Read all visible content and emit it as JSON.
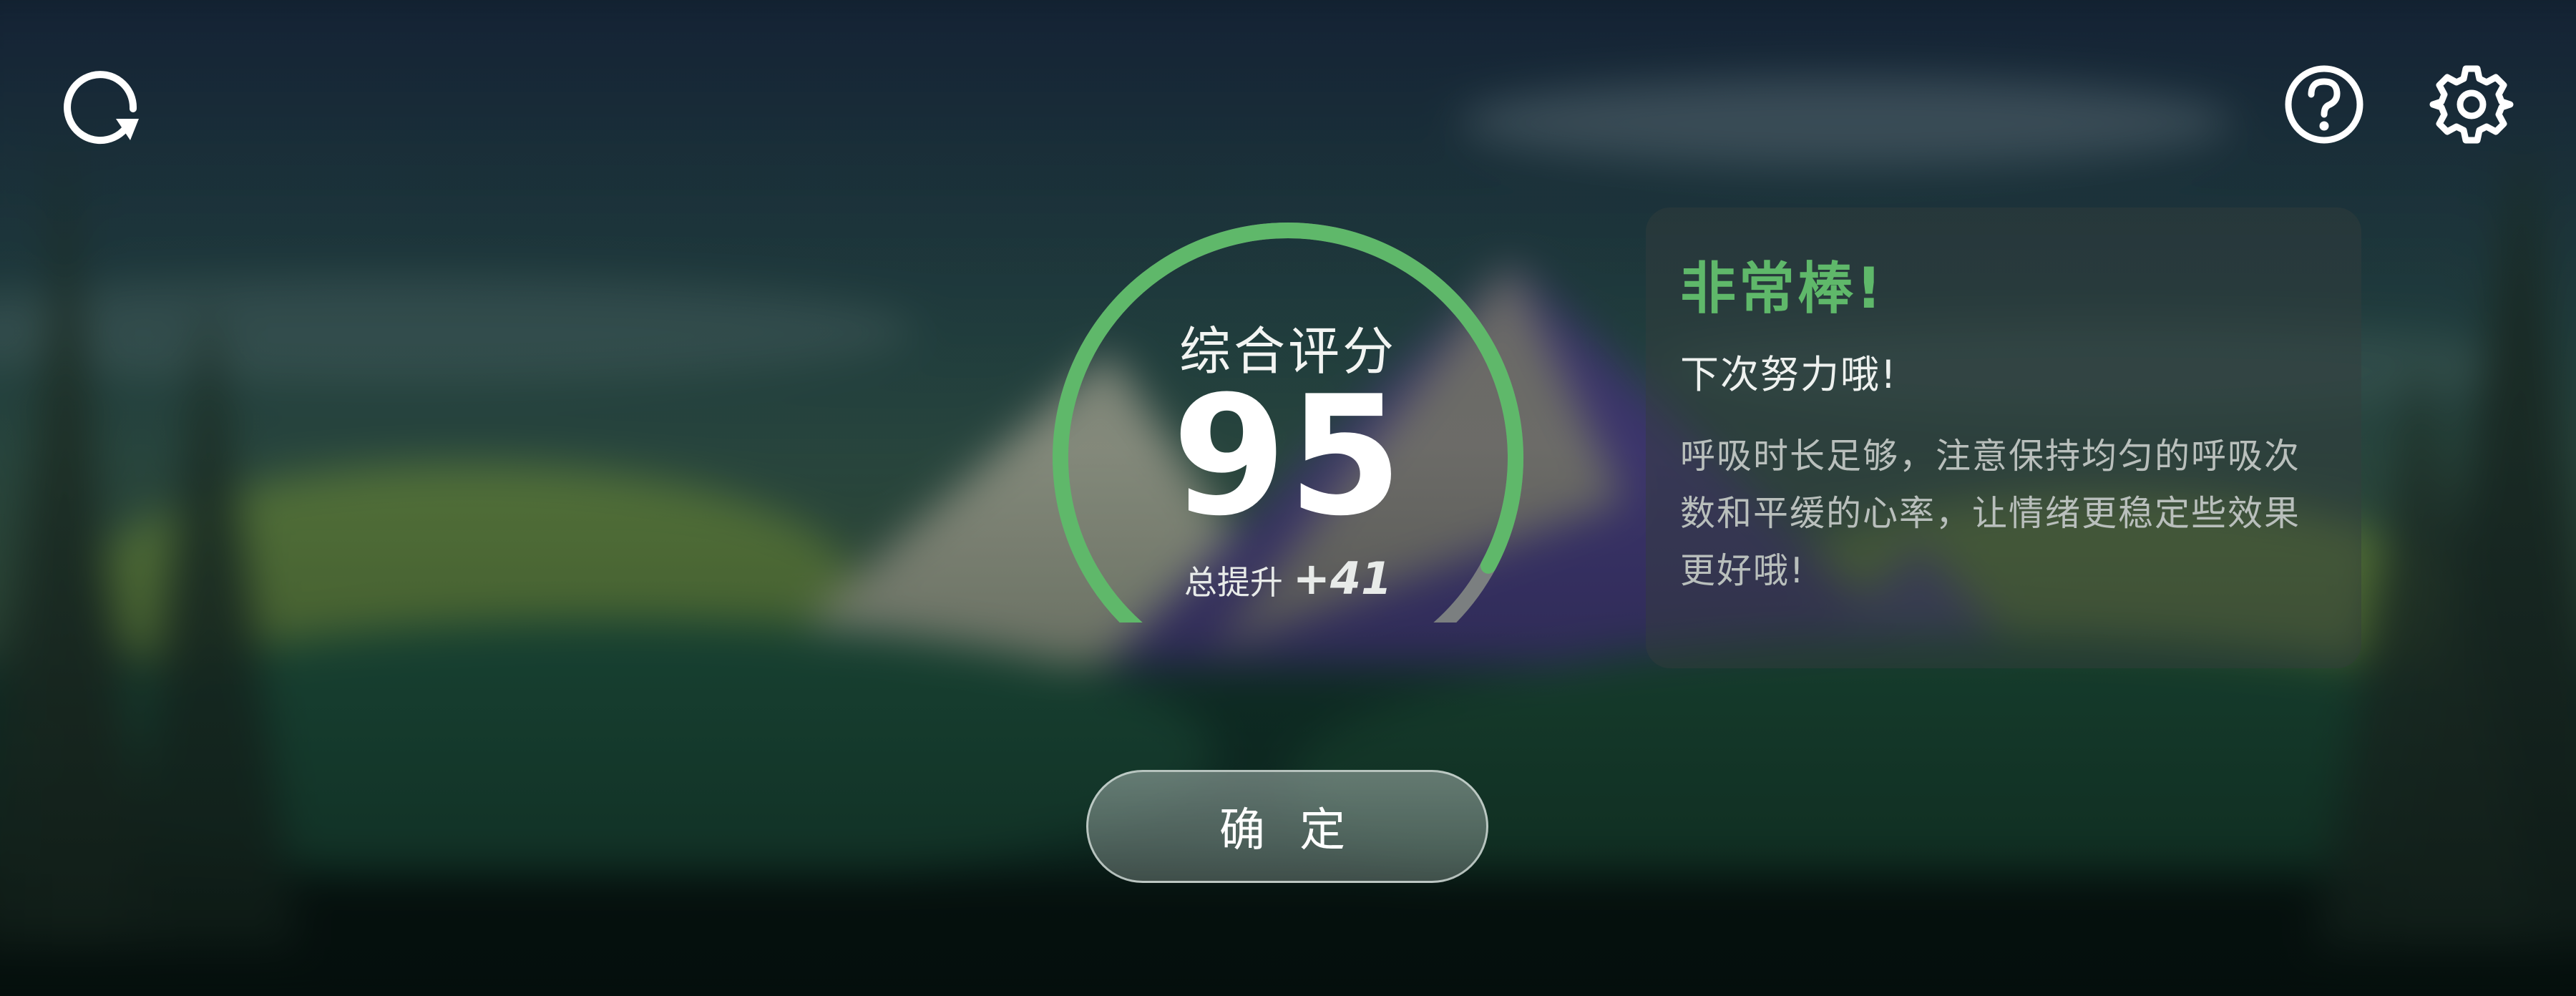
{
  "colors": {
    "accent_green": "#5fb86a",
    "gauge_track": "#7b7f80",
    "text_primary": "#ffffff",
    "text_secondary": "#b9bfbc"
  },
  "toolbar": {
    "refresh_icon": "refresh-icon",
    "help_icon": "question-circle-icon",
    "settings_icon": "gear-icon"
  },
  "score": {
    "title": "综合评分",
    "value": "95",
    "value_fraction": 0.95,
    "improvement_label": "总提升",
    "improvement_value": "+41"
  },
  "feedback": {
    "title": "非常棒!",
    "subtitle": "下次努力哦!",
    "body_lines": [
      "呼吸时长足够，注意保持均匀的呼吸次",
      "数和平缓的心率，让情绪更稳定些效果",
      "更好哦!"
    ]
  },
  "actions": {
    "confirm_label": "确 定"
  }
}
